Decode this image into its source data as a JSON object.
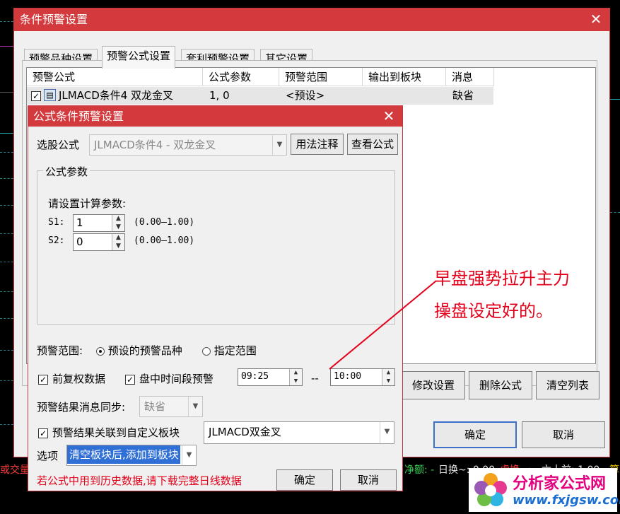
{
  "background": {
    "status_items": [
      {
        "text": "或交量",
        "color": "#ff3b3b"
      },
      {
        "text": "净额: -",
        "color": "#39d353"
      },
      {
        "text": "日换~: 0.00",
        "color": "#e8e8e8"
      },
      {
        "text": "虚换~: -",
        "color": "#ff3b3b"
      },
      {
        "text": "六十前: 1.00",
        "color": "#e8e8e8"
      },
      {
        "text": "算",
        "color": "#e5c100"
      }
    ]
  },
  "outer": {
    "title": "条件预警设置",
    "tabs": [
      "预警品种设置",
      "预警公式设置",
      "套利预警设置",
      "其它设置"
    ],
    "columns": [
      "预警公式",
      "公式参数",
      "预警范围",
      "输出到板块",
      "消息"
    ],
    "row": {
      "formula": "JLMACD条件4 双龙金叉",
      "params": "1, 0",
      "range": "<预设>",
      "output": "",
      "message": "缺省"
    },
    "buttons": {
      "modify": "修改设置",
      "delete": "删除公式",
      "clear": "清空列表",
      "ok": "确定",
      "cancel": "取消"
    }
  },
  "inner": {
    "title": "公式条件预警设置",
    "formula_label": "选股公式",
    "formula_value": "JLMACD条件4  - 双龙金叉",
    "usage_button": "用法注释",
    "view_button": "查看公式",
    "params_group": "公式参数",
    "params_prompt": "请设置计算参数:",
    "params": [
      {
        "name": "S1:",
        "value": "1",
        "range": "(0.00—1.00)"
      },
      {
        "name": "S2:",
        "value": "0",
        "range": "(0.00—1.00)"
      }
    ],
    "range_label": "预警范围:",
    "range_options": [
      "预设的预警品种",
      "指定范围"
    ],
    "range_selected": 0,
    "adjust_label": "前复权数据",
    "time_label": "盘中时间段预警",
    "time_from": "09:25",
    "time_sep": "--",
    "time_to": "10:00",
    "sync_label": "预警结果消息同步:",
    "sync_value": "缺省",
    "link_label": "预警结果关联到自定义板块",
    "link_value": "JLMACD双金叉",
    "option_label": "选项",
    "option_value": "清空板块后,添加到板块",
    "warning": "若公式中用到历史数据,请下载完整日线数据",
    "ok": "确定",
    "cancel": "取消"
  },
  "annotation": {
    "line1": "早盘强势拉升主力",
    "line2": "操盘设定好的。",
    "color": "#e2001a"
  },
  "logo": {
    "name": "分析家公式网",
    "url": "www.fxjgsw.com"
  },
  "icons": [
    "close-icon",
    "checkbox-icon",
    "formula-icon",
    "dropdown-arrow-icon",
    "spin-arrows-icon",
    "radio-icon",
    "flower-logo-icon"
  ]
}
